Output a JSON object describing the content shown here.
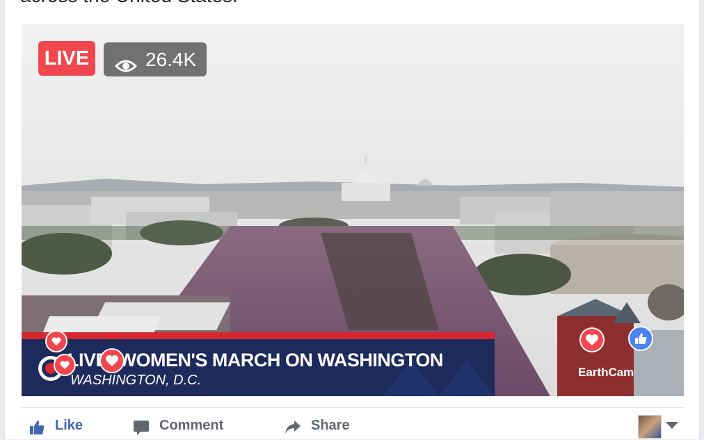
{
  "post": {
    "text": "across the United States."
  },
  "video": {
    "live_label": "LIVE",
    "viewer_count": "26.4K",
    "banner_title": "LIVE: WOMEN'S MARCH ON WASHINGTON",
    "banner_subtitle": "WASHINGTON, D.C.",
    "watermark": "EarthCam",
    "colors": {
      "live": "#f0474f",
      "banner": "#1c2a5c",
      "banner_stripe": "#d7262f",
      "heart": "#f0474f",
      "like": "#4b83f2"
    },
    "reactions": [
      {
        "type": "love",
        "icon": "heart-icon"
      },
      {
        "type": "love",
        "icon": "heart-icon"
      },
      {
        "type": "love",
        "icon": "heart-icon"
      },
      {
        "type": "love",
        "icon": "heart-icon"
      },
      {
        "type": "like",
        "icon": "thumbs-up-icon"
      }
    ]
  },
  "actions": {
    "like": "Like",
    "comment": "Comment",
    "share": "Share"
  }
}
